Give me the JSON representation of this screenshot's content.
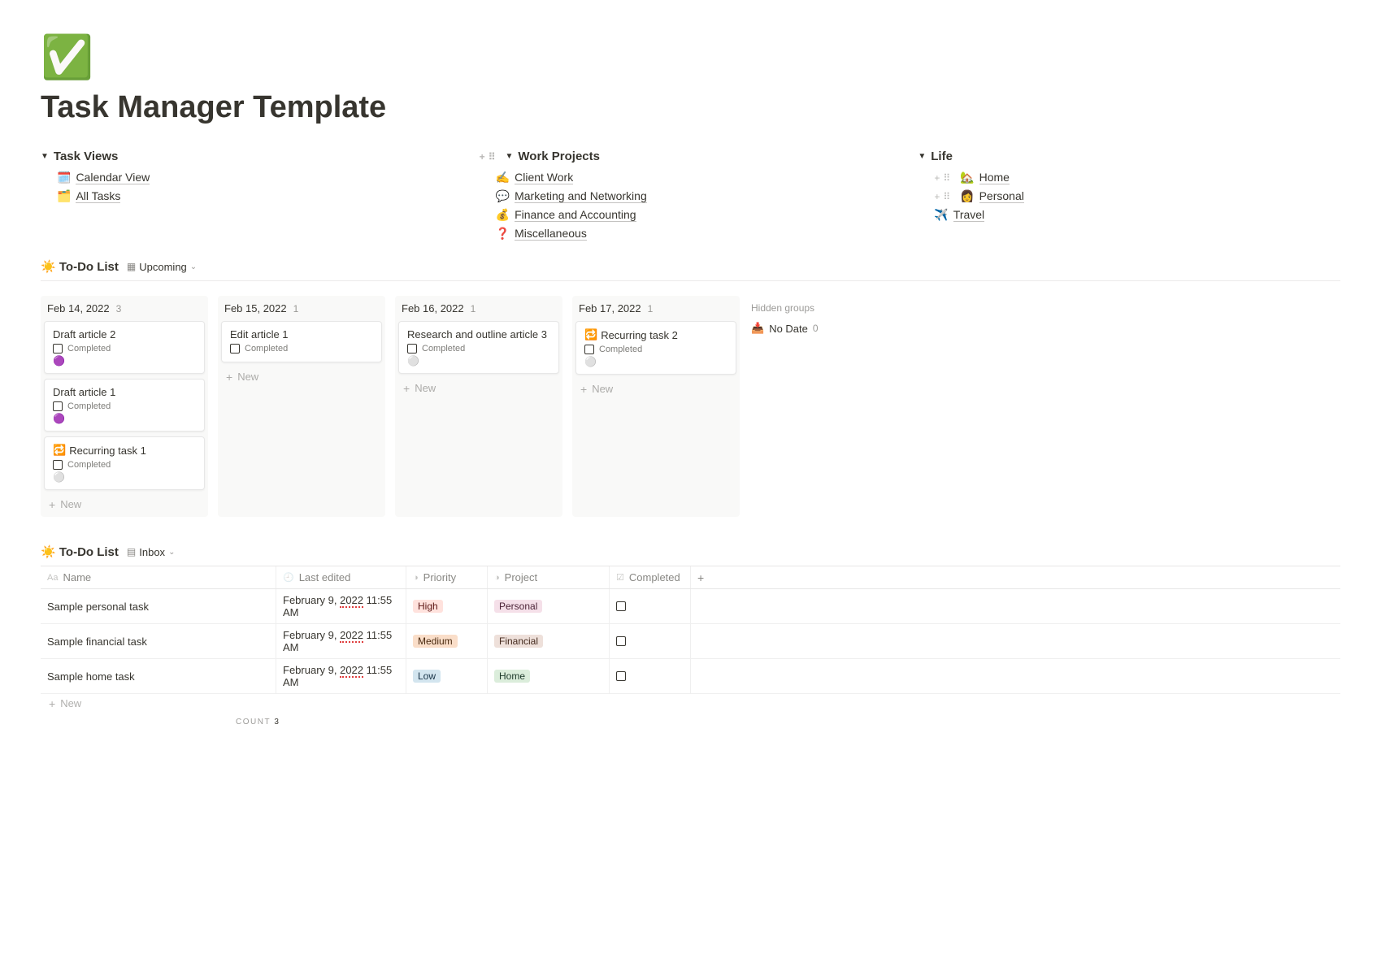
{
  "icon": "✅",
  "title": "Task Manager Template",
  "columns": [
    {
      "heading": "Task Views",
      "items": [
        {
          "emoji": "🗓️",
          "label": "Calendar View"
        },
        {
          "emoji": "🗂️",
          "label": "All Tasks"
        }
      ]
    },
    {
      "heading": "Work Projects",
      "items": [
        {
          "emoji": "✍️",
          "label": "Client Work"
        },
        {
          "emoji": "💬",
          "label": "Marketing and Networking"
        },
        {
          "emoji": "💰",
          "label": "Finance and Accounting"
        },
        {
          "emoji": "❓",
          "label": "Miscellaneous"
        }
      ]
    },
    {
      "heading": "Life",
      "items": [
        {
          "emoji": "🏡",
          "label": "Home"
        },
        {
          "emoji": "👩",
          "label": "Personal"
        },
        {
          "emoji": "✈️",
          "label": "Travel"
        }
      ]
    }
  ],
  "todo": {
    "emoji": "☀️",
    "title": "To-Do List",
    "view_label": "Upcoming",
    "board": [
      {
        "date": "Feb 14, 2022",
        "count": "3",
        "cards": [
          {
            "title": "Draft article 2",
            "completed_label": "Completed",
            "dot": "🟣"
          },
          {
            "title": "Draft article 1",
            "completed_label": "Completed",
            "dot": "🟣"
          },
          {
            "prefix": "🔁",
            "title": "Recurring task 1",
            "completed_label": "Completed",
            "dot": "⚪"
          }
        ]
      },
      {
        "date": "Feb 15, 2022",
        "count": "1",
        "cards": [
          {
            "title": "Edit article 1",
            "completed_label": "Completed"
          }
        ]
      },
      {
        "date": "Feb 16, 2022",
        "count": "1",
        "cards": [
          {
            "title": "Research and outline article 3",
            "completed_label": "Completed",
            "dot": "⚪"
          }
        ]
      },
      {
        "date": "Feb 17, 2022",
        "count": "1",
        "cards": [
          {
            "prefix": "🔁",
            "title": "Recurring task 2",
            "completed_label": "Completed",
            "dot": "⚪"
          }
        ]
      }
    ],
    "hidden_label": "Hidden groups",
    "hidden_items": [
      {
        "icon": "📥",
        "label": "No Date",
        "count": "0"
      }
    ],
    "new_label": "New"
  },
  "inbox": {
    "emoji": "☀️",
    "title": "To-Do List",
    "view_label": "Inbox",
    "headers": {
      "name": "Name",
      "last_edited": "Last edited",
      "priority": "Priority",
      "project": "Project",
      "completed": "Completed"
    },
    "rows": [
      {
        "name": "Sample personal task",
        "date_prefix": "February 9, ",
        "year": "2022",
        "time": " 11:55 AM",
        "priority": "High",
        "priority_class": "high",
        "project": "Personal",
        "project_class": "personal"
      },
      {
        "name": "Sample financial task",
        "date_prefix": "February 9, ",
        "year": "2022",
        "time": " 11:55 AM",
        "priority": "Medium",
        "priority_class": "medium",
        "project": "Financial",
        "project_class": "financial"
      },
      {
        "name": "Sample home task",
        "date_prefix": "February 9, ",
        "year": "2022",
        "time": " 11:55 AM",
        "priority": "Low",
        "priority_class": "low",
        "project": "Home",
        "project_class": "home"
      }
    ],
    "new_label": "New",
    "count_label": "COUNT",
    "count_value": "3"
  }
}
